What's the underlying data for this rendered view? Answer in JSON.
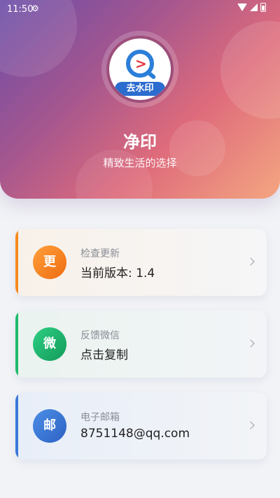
{
  "status_bar": {
    "time": "11:50",
    "icons": [
      "settings-gear-icon",
      "wifi-icon",
      "signal-icon",
      "battery-icon"
    ]
  },
  "header": {
    "logo_banner": "去水印",
    "title": "净印",
    "subtitle": "精致生活的选择"
  },
  "cards": [
    {
      "badge": "更",
      "label": "检查更新",
      "value": "当前版本: 1.4",
      "accent": "#f58a1f"
    },
    {
      "badge": "微",
      "label": "反馈微信",
      "value": "点击复制",
      "accent": "#1fb96b"
    },
    {
      "badge": "邮",
      "label": "电子邮箱",
      "value": "8751148@qq.com",
      "accent": "#3a78d8"
    }
  ]
}
